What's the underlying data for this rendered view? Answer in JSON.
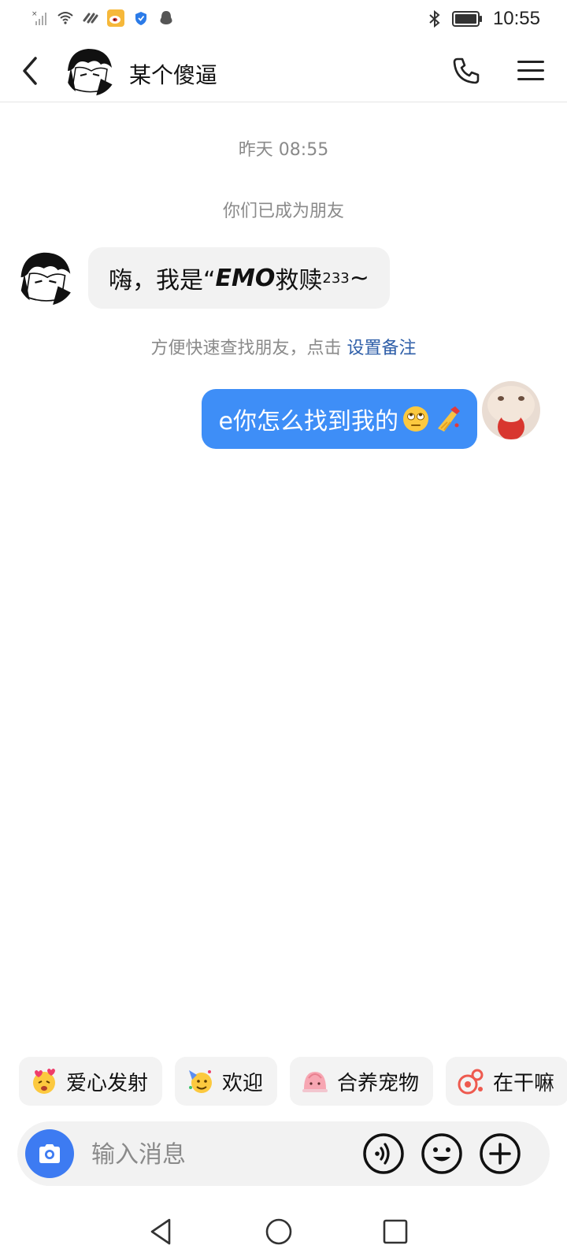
{
  "status_bar": {
    "time": "10:55",
    "icons": [
      "signal-off-icon",
      "wifi-icon",
      "link-icon",
      "weibo-icon",
      "shield-icon",
      "qq-icon",
      "bluetooth-icon",
      "battery-icon"
    ]
  },
  "header": {
    "title": "某个傻逼",
    "back_icon": "chevron-left-icon",
    "call_icon": "phone-icon",
    "menu_icon": "menu-icon"
  },
  "chat": {
    "timestamp": "昨天 08:55",
    "friend_notice": "你们已成为朋友",
    "incoming": {
      "prefix": "嗨，我是“",
      "emphasis": "EMO",
      "suffix": "救赎",
      "superscript": "233",
      "tail": "~"
    },
    "remark_hint": {
      "text": "方便快速查找朋友，点击 ",
      "link": "设置备注"
    },
    "outgoing": {
      "text": "e你怎么找到我的",
      "emojis": [
        "eye-roll-emoji",
        "nail-polish-emoji"
      ]
    }
  },
  "quick_chips": [
    {
      "label": "爱心发射",
      "emoji": "heart-face-emoji"
    },
    {
      "label": "欢迎",
      "emoji": "party-emoji"
    },
    {
      "label": "合养宠物",
      "emoji": "pet-emoji"
    },
    {
      "label": "在干嘛",
      "emoji": "doing-emoji"
    }
  ],
  "input_bar": {
    "placeholder": "输入消息",
    "camera_icon": "camera-icon",
    "voice_icon": "voice-icon",
    "emoji_icon": "smile-icon",
    "plus_icon": "plus-icon"
  },
  "nav_bar": {
    "icons": [
      "back-triangle-icon",
      "home-circle-icon",
      "recents-square-icon"
    ]
  },
  "colors": {
    "accent_blue": "#3e8ef7",
    "camera_blue": "#3d7bf2",
    "bubble_gray": "#f2f2f2",
    "link_blue": "#2e5ea8"
  }
}
